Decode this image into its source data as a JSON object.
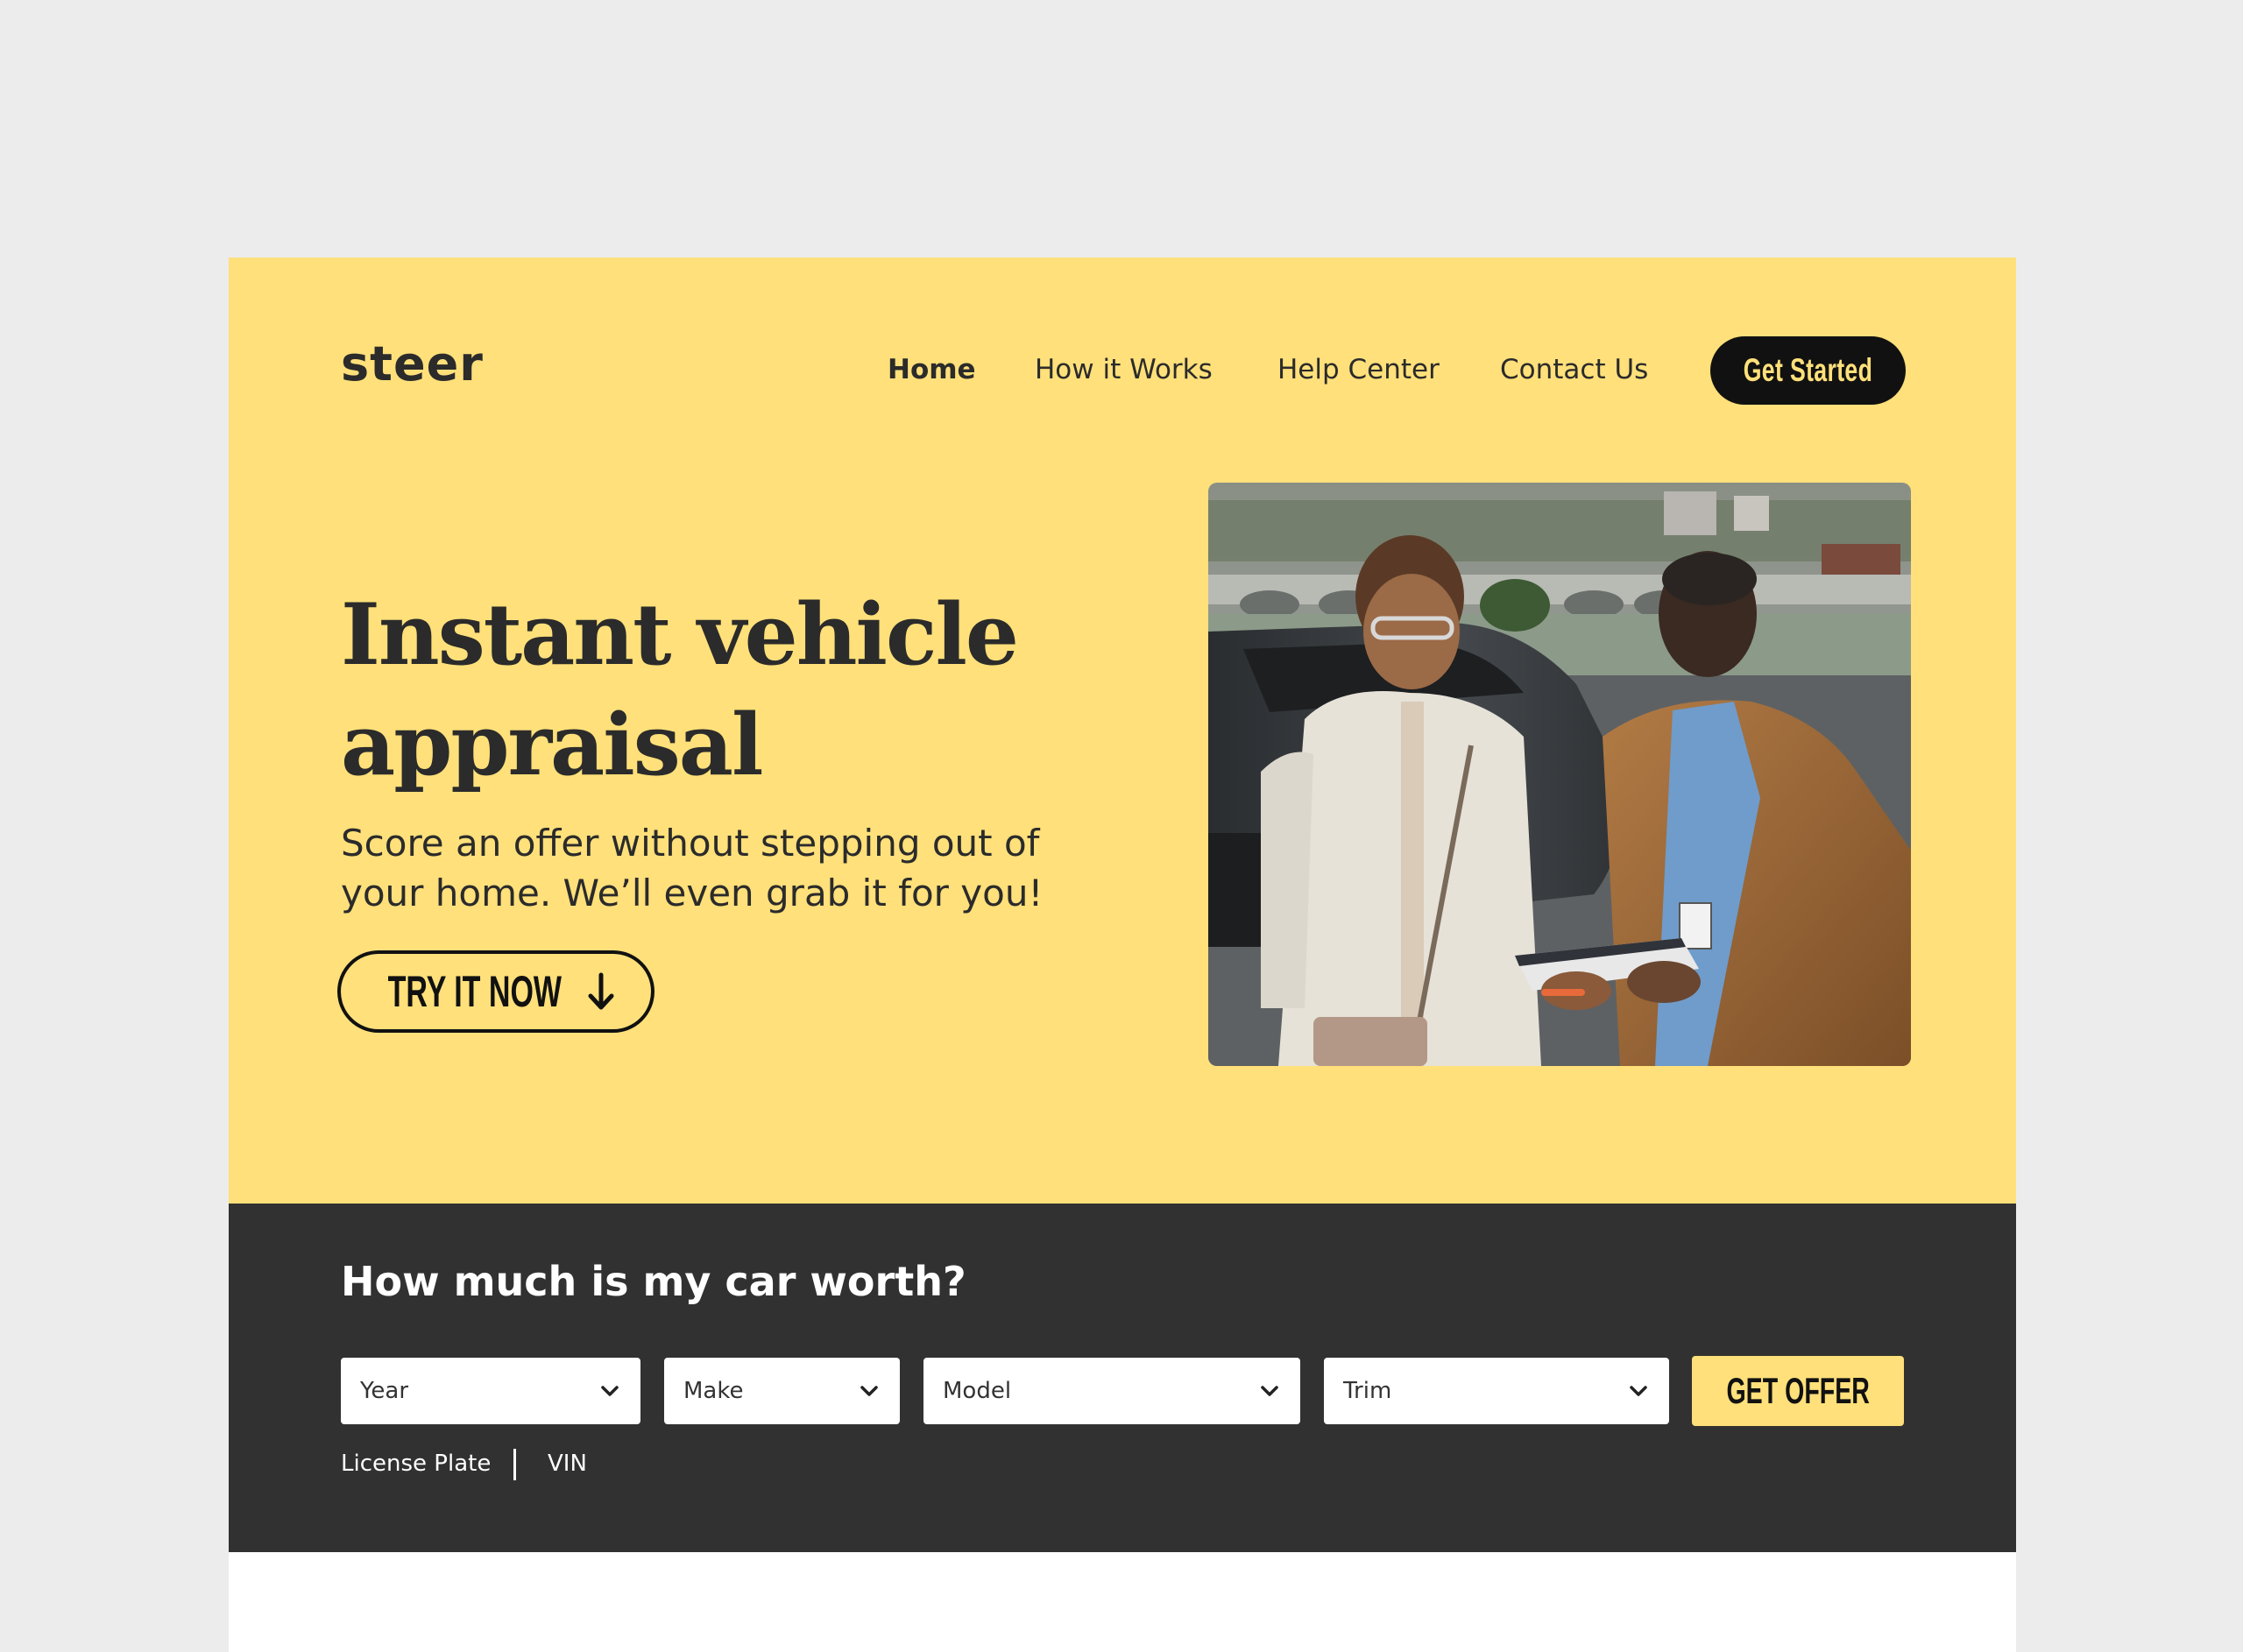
{
  "brand": {
    "logo_text": "steer",
    "accent_color": "#ffe07a",
    "dark_color": "#313131"
  },
  "nav": {
    "items": [
      {
        "label": "Home",
        "active": true
      },
      {
        "label": "How it Works",
        "active": false
      },
      {
        "label": "Help Center",
        "active": false
      },
      {
        "label": "Contact Us",
        "active": false
      }
    ],
    "cta_label": "Get Started"
  },
  "hero": {
    "headline_line1": "Instant vehicle",
    "headline_line2": "appraisal",
    "subhead_line1": "Score an offer without stepping out of",
    "subhead_line2": "your home. We’ll even grab it for you!",
    "try_label": "TRY IT NOW",
    "try_icon": "arrow-down-icon",
    "photo_alt": "Two people reviewing vehicle paperwork on a clipboard beside a car"
  },
  "valuation": {
    "title": "How much is my car worth?",
    "selects": [
      {
        "placeholder": "Year",
        "icon": "chevron-down-icon"
      },
      {
        "placeholder": "Make",
        "icon": "chevron-down-icon"
      },
      {
        "placeholder": "Model",
        "icon": "chevron-down-icon"
      },
      {
        "placeholder": "Trim",
        "icon": "chevron-down-icon"
      }
    ],
    "offer_label": "GET OFFER",
    "alt_links": [
      "License Plate",
      "VIN"
    ]
  }
}
